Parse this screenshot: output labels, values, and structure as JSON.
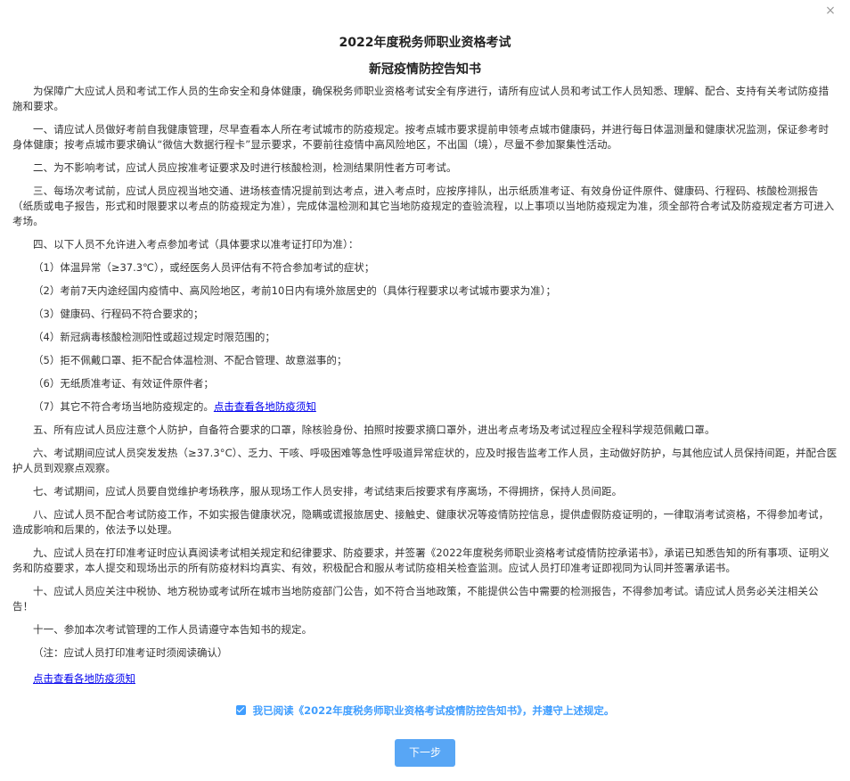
{
  "dialog": {
    "close_icon": "close-icon",
    "close_glyph": "×",
    "title": "2022年度税务师职业资格考试",
    "subtitle": "新冠疫情防控告知书"
  },
  "notice": {
    "intro": "为保障广大应试人员和考试工作人员的生命安全和身体健康，确保税务师职业资格考试安全有序进行，请所有应试人员和考试工作人员知悉、理解、配合、支持有关考试防疫措施和要求。",
    "p1": "一、请应试人员做好考前自我健康管理，尽早查看本人所在考试城市的防疫规定。按考点城市要求提前申领考点城市健康码，并进行每日体温测量和健康状况监测，保证参考时身体健康；按考点城市要求确认“微信大数据行程卡”显示要求，不要前往疫情中高风险地区，不出国（境），尽量不参加聚集性活动。",
    "p2": "二、为不影响考试，应试人员应按准考证要求及时进行核酸检测，检测结果阴性者方可考试。",
    "p3": "三、每场次考试前，应试人员应视当地交通、进场核查情况提前到达考点，进入考点时，应按序排队，出示纸质准考证、有效身份证件原件、健康码、行程码、核酸检测报告（纸质或电子报告，形式和时限要求以考点的防疫规定为准），完成体温检测和其它当地防疫规定的查验流程，以上事项以当地防疫规定为准，须全部符合考试及防疫规定者方可进入考场。",
    "p4": "四、以下人员不允许进入考点参加考试（具体要求以准考证打印为准）：",
    "items": [
      "（1）体温异常（≥37.3℃），或经医务人员评估有不符合参加考试的症状；",
      "（2）考前7天内途经国内疫情中、高风险地区，考前10日内有境外旅居史的（具体行程要求以考试城市要求为准）；",
      "（3）健康码、行程码不符合要求的；",
      "（4）新冠病毒核酸检测阳性或超过规定时限范围的；",
      "（5）拒不佩戴口罩、拒不配合体温检测、不配合管理、故意滋事的；",
      "（6）无纸质准考证、有效证件原件者；"
    ],
    "item7": "（7）其它不符合考场当地防疫规定的。",
    "item7_link": "点击查看各地防疫须知",
    "p5": "五、所有应试人员应注意个人防护，自备符合要求的口罩，除核验身份、拍照时按要求摘口罩外，进出考点考场及考试过程应全程科学规范佩戴口罩。",
    "p6": "六、考试期间应试人员突发发热（≥37.3°C）、乏力、干咳、呼吸困难等急性呼吸道异常症状的，应及时报告监考工作人员，主动做好防护，与其他应试人员保持间距，并配合医护人员到观察点观察。",
    "p7": "七、考试期间，应试人员要自觉维护考场秩序，服从现场工作人员安排，考试结束后按要求有序离场，不得拥挤，保持人员间距。",
    "p8": "八、应试人员不配合考试防疫工作，不如实报告健康状况，隐瞒或谎报旅居史、接触史、健康状况等疫情防控信息，提供虚假防疫证明的，一律取消考试资格，不得参加考试，造成影响和后果的，依法予以处理。",
    "p9": "九、应试人员在打印准考证时应认真阅读考试相关规定和纪律要求、防疫要求，并签署《2022年度税务师职业资格考试疫情防控承诺书》，承诺已知悉告知的所有事项、证明义务和防疫要求，本人提交和现场出示的所有防疫材料均真实、有效，积极配合和服从考试防疫相关检查监测。应试人员打印准考证即视同为认同并签署承诺书。",
    "p10": "十、应试人员应关注中税协、地方税协或考试所在城市当地防疫部门公告，如不符合当地政策，不能提供公告中需要的检测报告，不得参加考试。请应试人员务必关注相关公告！",
    "p11": "十一、参加本次考试管理的工作人员请遵守本告知书的规定。",
    "note": "（注：应试人员打印准考证时须阅读确认）",
    "bottom_link": "点击查看各地防疫须知"
  },
  "agreement": {
    "checked": true,
    "label": "我已阅读《2022年度税务师职业资格考试疫情防控告知书》，并遵守上述规定。"
  },
  "footer": {
    "next_label": "下一步"
  },
  "colors": {
    "accent": "#409eff",
    "button": "#58a6f5",
    "link": "#0000ee",
    "text": "#333333"
  }
}
